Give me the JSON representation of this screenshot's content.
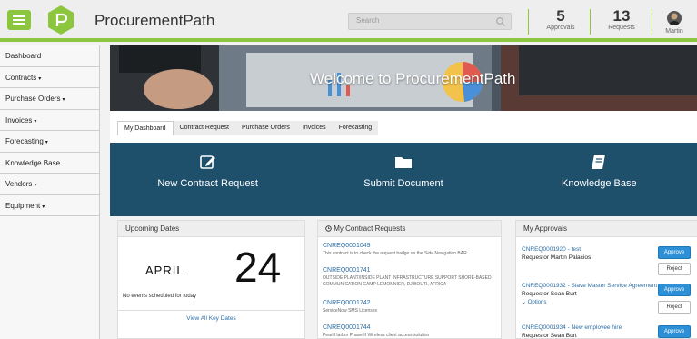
{
  "header": {
    "brand": "ProcurementPath",
    "search_placeholder": "Search",
    "approvals_count": "5",
    "approvals_label": "Approvals",
    "requests_count": "13",
    "requests_label": "Requests",
    "user_name": "Martin"
  },
  "sidebar": {
    "items": [
      {
        "label": "Dashboard"
      },
      {
        "label": "Contracts"
      },
      {
        "label": "Purchase Orders"
      },
      {
        "label": "Invoices"
      },
      {
        "label": "Forecasting"
      },
      {
        "label": "Knowledge Base"
      },
      {
        "label": "Vendors"
      },
      {
        "label": "Equipment"
      }
    ],
    "caret": "▾"
  },
  "banner": {
    "title": "Welcome to ProcurementPath"
  },
  "tabs": [
    "My Dashboard",
    "Contract Request",
    "Purchase Orders",
    "Invoices",
    "Forecasting"
  ],
  "actions": [
    {
      "label": "New Contract Request",
      "icon": "edit-icon"
    },
    {
      "label": "Submit Document",
      "icon": "folder-icon"
    },
    {
      "label": "Knowledge Base",
      "icon": "book-icon"
    }
  ],
  "upcoming": {
    "title": "Upcoming Dates",
    "month": "APRIL",
    "day": "24",
    "no_events": "No events scheduled for today",
    "view_all": "View All Key Dates"
  },
  "contract_requests": {
    "title": "My Contract Requests",
    "items": [
      {
        "id": "CNREQ0001049",
        "desc": "This contract is to check the request badge on the Side Navigation BAR"
      },
      {
        "id": "CNREQ0001741",
        "desc": "OUTSIDE PLANT/INSIDE PLANT INFRASTRUCTURE SUPPORT SHORE-BASED COMMUNICATION CAMP LEMONNIER, DJIBOUTI, AFRICA"
      },
      {
        "id": "CNREQ0001742",
        "desc": "ServiceNow SMS Licenses"
      },
      {
        "id": "CNREQ0001744",
        "desc": "Pearl Harbor Phase II Wireless client access solution"
      }
    ]
  },
  "approvals": {
    "title": "My Approvals",
    "approve_label": "Approve",
    "reject_label": "Reject",
    "options_label": "Options",
    "items": [
      {
        "id": "CNREQ0001920 - test",
        "requestor": "Requestor Martin Palacios"
      },
      {
        "id": "CNREQ0001932 - Slave Master Service Agreement",
        "requestor": "Requestor Sean Burt"
      },
      {
        "id": "CNREQ0001934 - New employee hire",
        "requestor": "Requestor Sean Burt"
      }
    ]
  },
  "colors": {
    "accent_green": "#8cc63f",
    "action_bar_blue": "#1e4f6b",
    "link_blue": "#2b6ca3",
    "approve_blue": "#2d8fd6"
  }
}
